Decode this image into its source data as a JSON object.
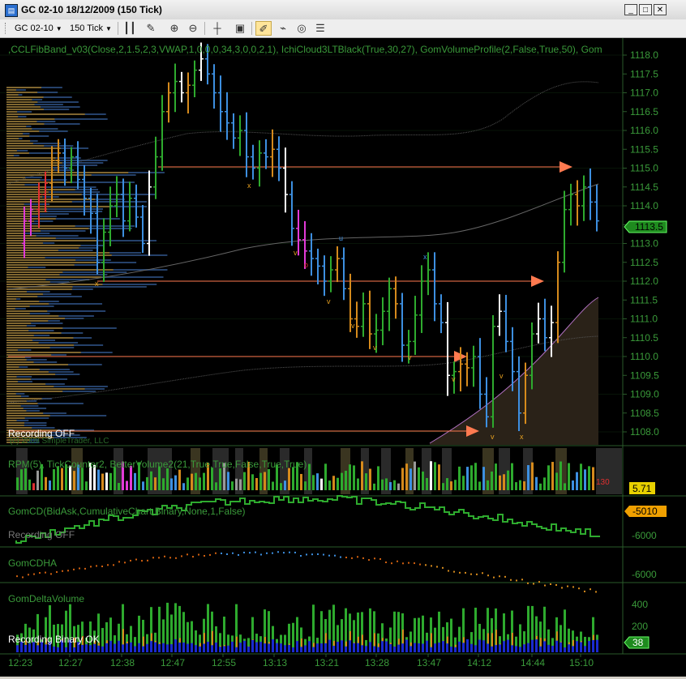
{
  "window": {
    "title": "GC 02-10  18/12/2009 (150 Tick)",
    "icon": "chart-window-icon",
    "buttons": [
      "minimize-icon",
      "maximize-icon",
      "close-icon"
    ]
  },
  "toolbar": {
    "instrument": "GC 02-10",
    "interval": "150 Tick",
    "buttons": [
      "bar-type-icon",
      "drawing-tool-icon",
      "zoom-in-icon",
      "zoom-out-icon",
      "crosshair-icon",
      "properties-icon",
      "data-box-icon",
      "chart-trader-icon",
      "strategies-icon",
      "indicators-icon"
    ]
  },
  "colors": {
    "background": "#000000",
    "grid": "#1e3a1e",
    "text": "#3a9a3a",
    "price_tag": "#22cc22",
    "up": "#2eaa2e",
    "down": "#3d8fe0",
    "neutral_up": "#d58a1c",
    "white": "#ffffff",
    "arrow": "#ff7a50"
  },
  "price_panel": {
    "indicator_label": ",CCLFibBand_v03(Close,2,1.5,2,3,VWAP,1,0,0,0,34,3,0,0,2,1),  IchiCloud3LTBlack(True,30,27),  GomVolumeProfile(2,False,True,50),  Gom",
    "recording_label": "Recording OFF",
    "copyright_label": "(c) 2009 SimpleTrader, LLC",
    "y_ticks": [
      "1118.0",
      "1117.5",
      "1117.0",
      "1116.5",
      "1116.0",
      "1115.5",
      "1115.0",
      "1114.5",
      "1114.0",
      "1113.5",
      "1113.0",
      "1112.5",
      "1112.0",
      "1111.5",
      "1111.0",
      "1110.5",
      "1110.0",
      "1109.5",
      "1109.0",
      "1108.5",
      "1108.0"
    ],
    "current_price": "1113.5",
    "bar_markers": [
      "v",
      "x",
      "o",
      "u"
    ]
  },
  "rpm_panel": {
    "label": "RPM(5),  TickCounter2,  BetterVolume2(21,True,True,False,True,True)",
    "counter_text": "130",
    "value_tag": "5.71"
  },
  "gomcd_panel": {
    "label": "GomCD(BidAsk,CumulativeChart,Binary,None,1,False)",
    "recording_label": "Recording OFF",
    "y_tick": "-6000",
    "value_tag": "-5010"
  },
  "gomcdha_panel": {
    "label": "GomCDHA",
    "y_tick": "-6000"
  },
  "delta_panel": {
    "label": "GomDeltaVolume",
    "recording_label": "Recording Binary OK",
    "y_ticks": [
      "400",
      "200"
    ],
    "value_tag": "38"
  },
  "x_axis": {
    "ticks": [
      "12:23",
      "12:27",
      "12:38",
      "12:47",
      "12:55",
      "13:13",
      "13:21",
      "13:28",
      "13:47",
      "14:12",
      "14:44",
      "15:10"
    ]
  }
}
